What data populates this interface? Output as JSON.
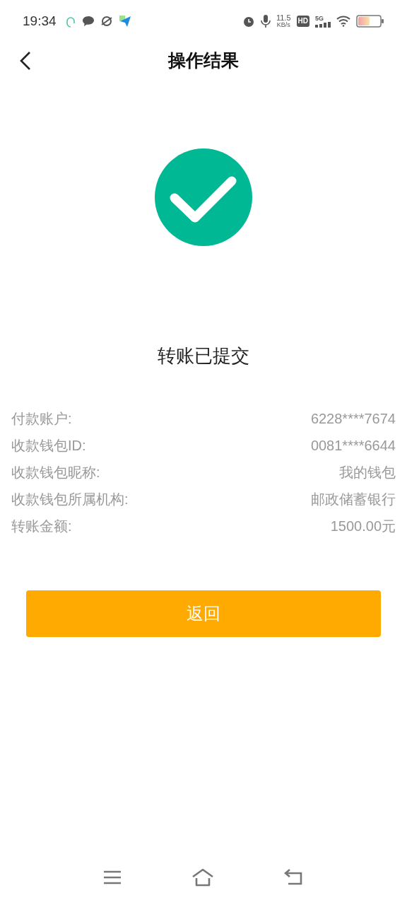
{
  "status_bar": {
    "time": "19:34",
    "speed_value": "11.5",
    "speed_unit": "KB/s",
    "hd": "HD",
    "network": "5G"
  },
  "header": {
    "title": "操作结果"
  },
  "result": {
    "message": "转账已提交"
  },
  "details": [
    {
      "label": "付款账户:",
      "value": "6228****7674"
    },
    {
      "label": "收款钱包ID:",
      "value": "0081****6644"
    },
    {
      "label": "收款钱包昵称:",
      "value": "我的钱包"
    },
    {
      "label": "收款钱包所属机构:",
      "value": "邮政储蓄银行"
    },
    {
      "label": "转账金额:",
      "value": "1500.00元"
    }
  ],
  "button": {
    "label": "返回"
  }
}
